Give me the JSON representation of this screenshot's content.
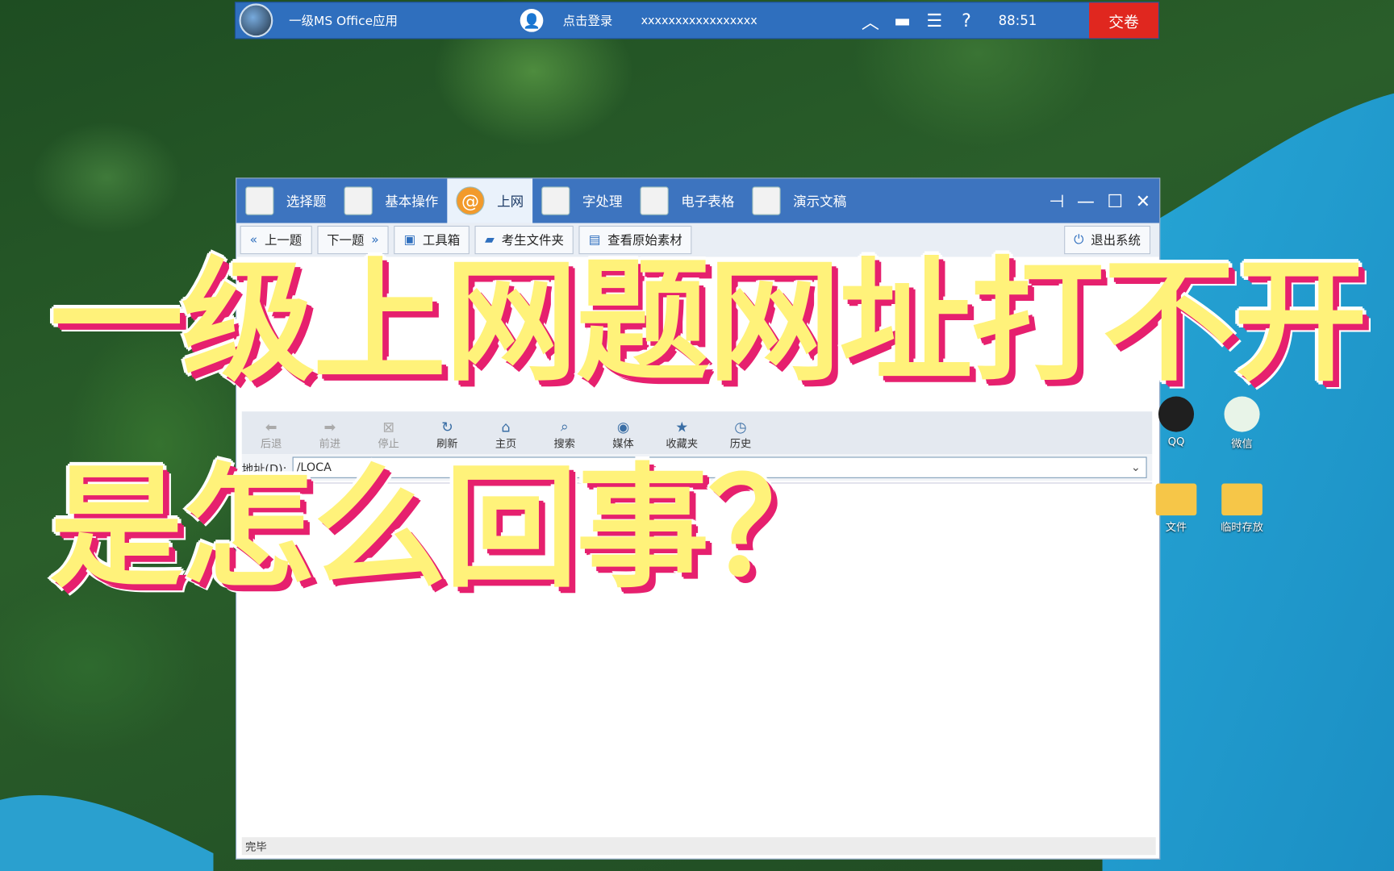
{
  "topbar": {
    "title": "一级MS Office应用",
    "login": "点击登录",
    "candidate_id": "xxxxxxxxxxxxxxxxx",
    "time": "88:51",
    "submit": "交卷"
  },
  "menubar": {
    "tabs": [
      {
        "label": "选择题"
      },
      {
        "label": "基本操作"
      },
      {
        "label": "上网"
      },
      {
        "label": "字处理"
      },
      {
        "label": "电子表格"
      },
      {
        "label": "演示文稿"
      }
    ],
    "active_tab": "上网"
  },
  "toolrow": {
    "prev": "上一题",
    "next": "下一题",
    "toolbox": "工具箱",
    "folder": "考生文件夹",
    "material": "查看原始素材",
    "exit": "退出系统"
  },
  "browser": {
    "buttons": [
      {
        "label": "后退",
        "icon": "back-arrow-icon",
        "enabled": false
      },
      {
        "label": "前进",
        "icon": "forward-arrow-icon",
        "enabled": false
      },
      {
        "label": "停止",
        "icon": "stop-icon",
        "enabled": false
      },
      {
        "label": "刷新",
        "icon": "refresh-icon",
        "enabled": true
      },
      {
        "label": "主页",
        "icon": "home-icon",
        "enabled": true
      },
      {
        "label": "搜索",
        "icon": "search-icon",
        "enabled": true
      },
      {
        "label": "媒体",
        "icon": "media-icon",
        "enabled": true
      },
      {
        "label": "收藏夹",
        "icon": "favorites-icon",
        "enabled": true
      },
      {
        "label": "历史",
        "icon": "history-icon",
        "enabled": true
      }
    ],
    "address_label": "地址(D):",
    "address_value": "/LOCA",
    "status": "完毕"
  },
  "desktop_icons": [
    {
      "label": "QQ"
    },
    {
      "label": "微信"
    },
    {
      "label": "文件"
    },
    {
      "label": "临时存放"
    }
  ],
  "headline": {
    "line1": "一级上网题网址打不开",
    "line2": "是怎么回事？"
  },
  "colors": {
    "title_bar": "#2f6fbe",
    "submit_button": "#e0271f",
    "headline_fill": "#fff27a",
    "headline_shadow": "#e6206e"
  }
}
